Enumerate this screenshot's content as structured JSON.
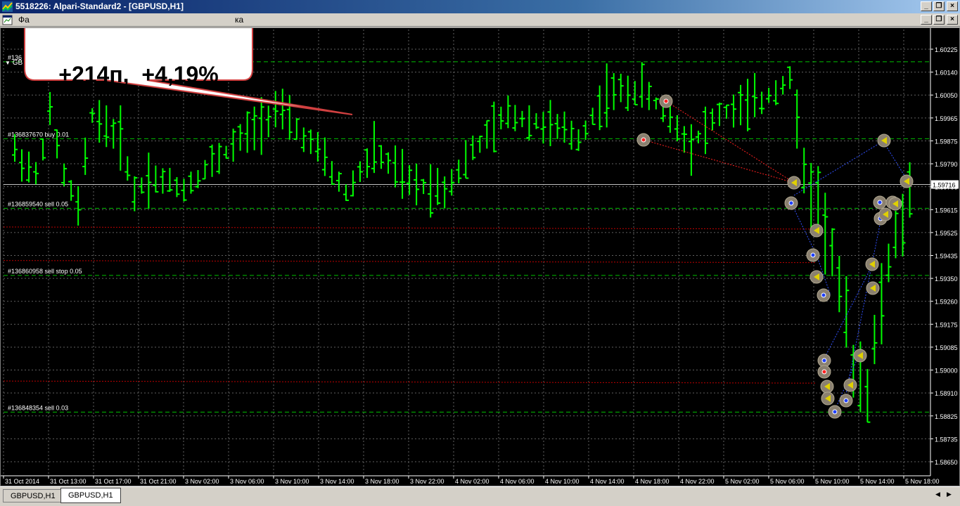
{
  "window": {
    "title": "5518226: Alpari-Standard2 - [GBPUSD,H1]",
    "min_glyph": "_",
    "restore_glyph": "❐",
    "close_glyph": "×"
  },
  "menu": {
    "file": "Фа",
    "tail": "ка"
  },
  "symbol_label": "GB",
  "callout": {
    "text": "+214п,  +4,19%"
  },
  "tabs": [
    {
      "label": "GBPUSD,H1",
      "active": false
    },
    {
      "label": "GBPUSD,H1",
      "active": true
    }
  ],
  "chart_data": {
    "type": "ohlc",
    "symbol": "GBPUSD",
    "timeframe": "H1",
    "price_axis": {
      "labels": [
        "1.60225",
        "1.60140",
        "1.60050",
        "1.59965",
        "1.59875",
        "1.59790",
        "1.59706",
        "1.59615",
        "1.59525",
        "1.59435",
        "1.59350",
        "1.59260",
        "1.59175",
        "1.59085",
        "1.59000",
        "1.58910",
        "1.58825",
        "1.58735",
        "1.58650"
      ],
      "current_price": "1.59716",
      "ylim": [
        1.5862,
        1.603
      ]
    },
    "time_axis": {
      "labels": [
        "31 Oct 2014",
        "31 Oct 13:00",
        "31 Oct 17:00",
        "31 Oct 21:00",
        "3 Nov 02:00",
        "3 Nov 06:00",
        "3 Nov 10:00",
        "3 Nov 14:00",
        "3 Nov 18:00",
        "3 Nov 22:00",
        "4 Nov 02:00",
        "4 Nov 06:00",
        "4 Nov 10:00",
        "4 Nov 14:00",
        "4 Nov 18:00",
        "4 Nov 22:00",
        "5 Nov 02:00",
        "5 Nov 06:00",
        "5 Nov 10:00",
        "5 Nov 14:00",
        "5 Nov 18:00"
      ]
    },
    "order_lines": [
      {
        "label": "#136",
        "price": 1.6021,
        "color": "#00c000"
      },
      {
        "label": "#136837670 buy 0.01",
        "price": 1.599,
        "color": "#00c000"
      },
      {
        "label": "#136859540 sell 0.05",
        "price": 1.5962,
        "color": "#00c000"
      },
      {
        "label": "#136860958 sell stop 0.05",
        "price": 1.5935,
        "color": "#00c000"
      },
      {
        "label": "#136848354 sell 0.03",
        "price": 1.588,
        "color": "#00c000"
      }
    ],
    "red_lines": [
      1.59545,
      1.5941,
      1.58925
    ],
    "colors": {
      "bars": "#00ff00",
      "grid": "#606060",
      "order": "#00c000",
      "stop": "#c00000"
    }
  }
}
